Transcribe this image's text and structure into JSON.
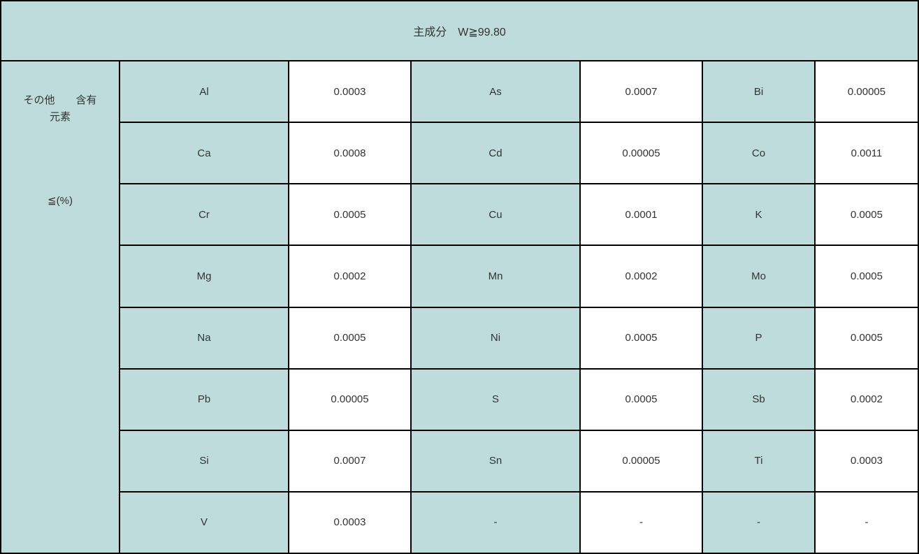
{
  "header": "主成分　W≧99.80",
  "leftLabel": {
    "line1": "その他　　含有",
    "line2": "元素",
    "line3": "≦(%)"
  },
  "rows": [
    {
      "e1": "Al",
      "v1": "0.0003",
      "e2": "As",
      "v2": "0.0007",
      "e3": "Bi",
      "v3": "0.00005"
    },
    {
      "e1": "Ca",
      "v1": "0.0008",
      "e2": "Cd",
      "v2": "0.00005",
      "e3": "Co",
      "v3": "0.0011"
    },
    {
      "e1": "Cr",
      "v1": "0.0005",
      "e2": "Cu",
      "v2": "0.0001",
      "e3": "K",
      "v3": "0.0005"
    },
    {
      "e1": "Mg",
      "v1": "0.0002",
      "e2": "Mn",
      "v2": "0.0002",
      "e3": "Mo",
      "v3": "0.0005"
    },
    {
      "e1": "Na",
      "v1": "0.0005",
      "e2": "Ni",
      "v2": "0.0005",
      "e3": "P",
      "v3": "0.0005"
    },
    {
      "e1": "Pb",
      "v1": "0.00005",
      "e2": "S",
      "v2": "0.0005",
      "e3": "Sb",
      "v3": "0.0002"
    },
    {
      "e1": "Si",
      "v1": "0.0007",
      "e2": "Sn",
      "v2": "0.00005",
      "e3": "Ti",
      "v3": "0.0003"
    },
    {
      "e1": "V",
      "v1": "0.0003",
      "e2": "-",
      "v2": "-",
      "e3": "-",
      "v3": "-"
    }
  ]
}
